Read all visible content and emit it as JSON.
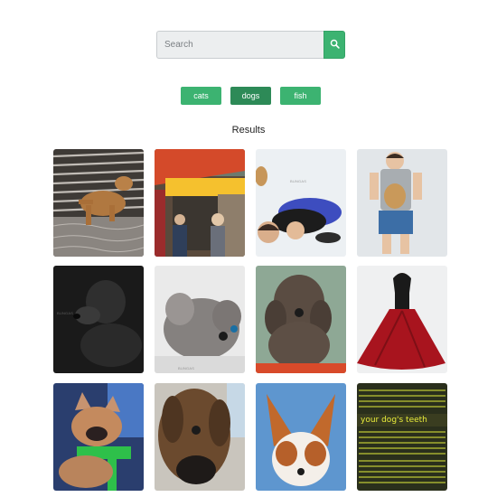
{
  "search": {
    "placeholder": "Search",
    "value": "",
    "button_icon": "search-icon"
  },
  "tags": [
    {
      "label": "cats",
      "active": false
    },
    {
      "label": "dogs",
      "active": true
    },
    {
      "label": "fish",
      "active": false
    }
  ],
  "results": {
    "title": "Results",
    "images": [
      {
        "subject": "dog-in-water",
        "watermark": ""
      },
      {
        "subject": "street-market",
        "watermark": ""
      },
      {
        "subject": "children-with-dog",
        "watermark": "BUNGAS"
      },
      {
        "subject": "boy-holding-dog",
        "watermark": ""
      },
      {
        "subject": "black-dog-portrait",
        "watermark": "BUNGAS"
      },
      {
        "subject": "grey-poodle-lying",
        "watermark": "BUNGAS"
      },
      {
        "subject": "curly-dog",
        "watermark": ""
      },
      {
        "subject": "woman-in-red-skirt",
        "watermark": ""
      },
      {
        "subject": "french-bulldog-green-harness",
        "watermark": ""
      },
      {
        "subject": "fluffy-dog-closeup",
        "watermark": ""
      },
      {
        "subject": "papillon-dog",
        "watermark": ""
      },
      {
        "subject": "dog-teeth-text-poster",
        "watermark": "",
        "poster_headline": "your dog's teeth"
      }
    ]
  },
  "colors": {
    "accent": "#3cb371",
    "accent_active": "#2d8a57",
    "input_bg": "#eceeef"
  }
}
